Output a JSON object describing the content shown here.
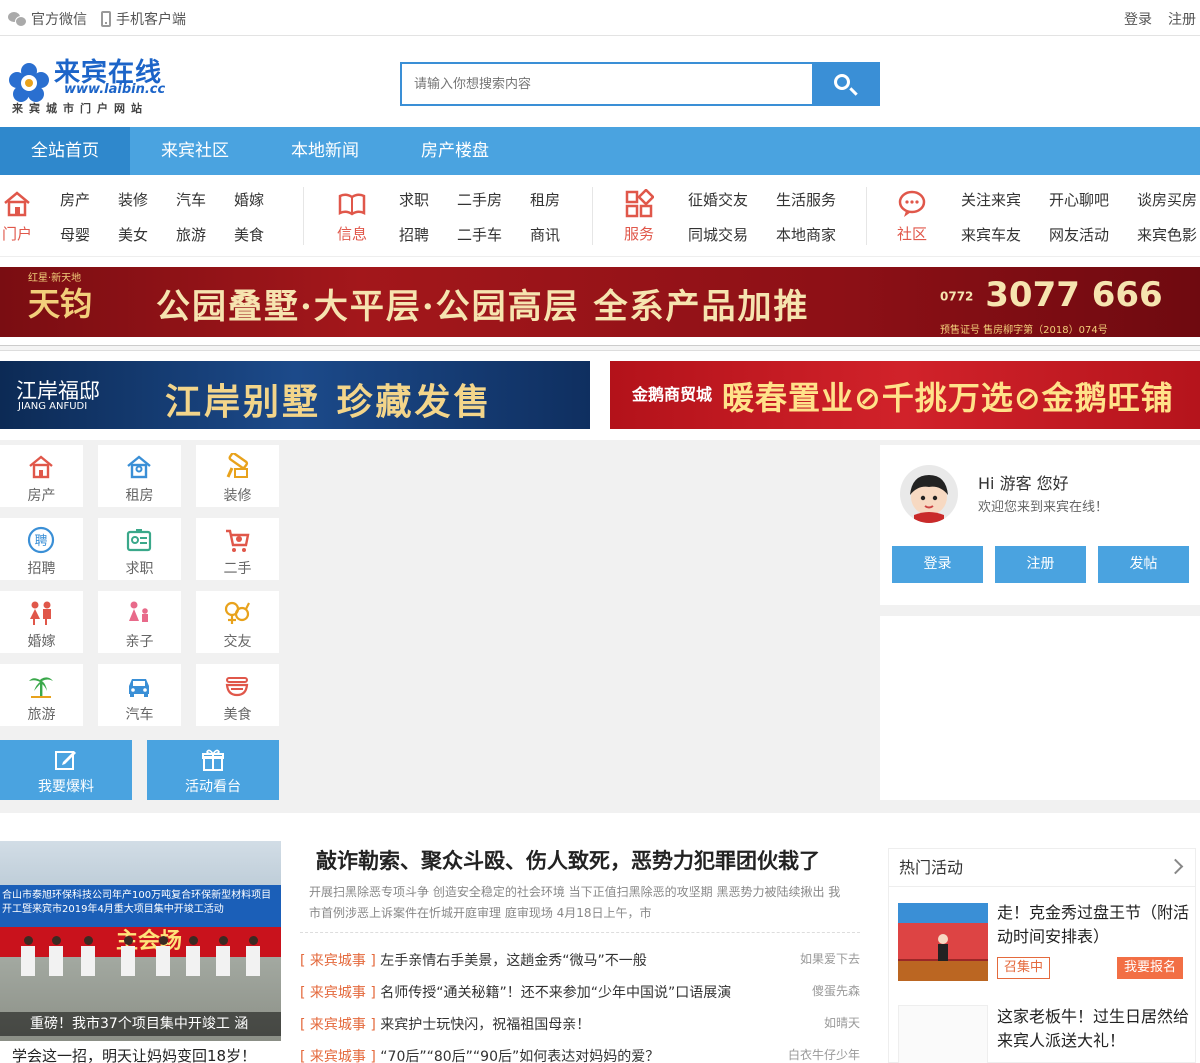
{
  "topbar": {
    "wechat": "官方微信",
    "mobile": "手机客户端",
    "login": "登录",
    "register": "注册"
  },
  "logo": {
    "name": "来宾在线",
    "url": "www.laibin.cc",
    "slogan": "来宾城市门户网站"
  },
  "search": {
    "placeholder": "请输入你想搜索内容"
  },
  "mainnav": [
    "全站首页",
    "来宾社区",
    "本地新闻",
    "房产楼盘"
  ],
  "subnav": {
    "portal": {
      "label": "门户",
      "links": [
        "房产",
        "装修",
        "汽车",
        "婚嫁",
        "母婴",
        "美女",
        "旅游",
        "美食"
      ]
    },
    "info": {
      "label": "信息",
      "links": [
        "求职",
        "二手房",
        "租房",
        "招聘",
        "二手车",
        "商讯"
      ]
    },
    "service": {
      "label": "服务",
      "links": [
        "征婚交友",
        "生活服务",
        "同城交易",
        "本地商家"
      ]
    },
    "community": {
      "label": "社区",
      "links": [
        "关注来宾",
        "开心聊吧",
        "谈房买房",
        "来宾车友",
        "网友活动",
        "来宾色影"
      ]
    }
  },
  "banners": {
    "b1": {
      "brand_small": "红星·新天地",
      "brand": "天钧",
      "main": "公园叠墅·大平层·公园高层 全系产品加推",
      "tel_prefix": "0772",
      "tel": "3077 666",
      "license": "预售证号 售房柳字第（2018）074号"
    },
    "b2": {
      "brand": "江岸福邸",
      "brand_en": "JIANG ANFUDI",
      "main": "江岸别墅 珍藏发售"
    },
    "b3": {
      "brand": "金鹅商贸城",
      "main": "暖春置业⊘千挑万选⊘金鹅旺铺"
    }
  },
  "tiles": [
    "房产",
    "租房",
    "装修",
    "招聘",
    "求职",
    "二手",
    "婚嫁",
    "亲子",
    "交友",
    "旅游",
    "汽车",
    "美食"
  ],
  "bigbuttons": [
    "我要爆料",
    "活动看台"
  ],
  "user": {
    "hi": "Hi 游客 您好",
    "welcome": "欢迎您来到来宾在线！",
    "login": "登录",
    "register": "注册",
    "post": "发帖"
  },
  "photo": {
    "banner_text": "合山市泰旭环保科技公司年产100万吨复合环保新型材料项目开工暨来宾市2019年4月重大项目集中开竣工活动",
    "stage": "主会场",
    "caption": "重磅！我市37个项目集中开竣工 涵",
    "below": "学会这一招，明天让妈妈变回18岁！"
  },
  "headline": {
    "title": "敲诈勒索、聚众斗殴、伤人致死，恶势力犯罪团伙栽了",
    "summary": "开展扫黑除恶专项斗争 创造安全稳定的社会环境 当下正值扫黑除恶的攻坚期 黑恶势力被陆续揪出 我市首例涉恶上诉案件在忻城开庭审理 庭审现场 4月18日上午，市"
  },
  "news": [
    {
      "tag": "[ 来宾城事 ]",
      "title": "左手亲情右手美景，这趟金秀“微马”不一般",
      "author": "如果爱下去"
    },
    {
      "tag": "[ 来宾城事 ]",
      "title": "名师传授“通关秘籍”！还不来参加“少年中国说”口语展演",
      "author": "傻蛋先森"
    },
    {
      "tag": "[ 来宾城事 ]",
      "title": "来宾护士玩快闪，祝福祖国母亲！",
      "author": "如晴天"
    },
    {
      "tag": "[ 来宾城事 ]",
      "title": "“70后”“80后”“90后”如何表达对妈妈的爱？",
      "author": "白衣牛仔少年"
    }
  ],
  "hot": {
    "title": "热门活动",
    "item1": {
      "title": "走！克金秀过盘王节（附活动时间安排表）",
      "badge": "召集中",
      "signup": "我要报名"
    },
    "item2": {
      "title": "这家老板牛！过生日居然给来宾人派送大礼！"
    }
  },
  "colors": {
    "primary": "#4aa3e0",
    "accent": "#e46a3d",
    "icon_red": "#e0574a",
    "icon_blue": "#3a8fd6"
  }
}
